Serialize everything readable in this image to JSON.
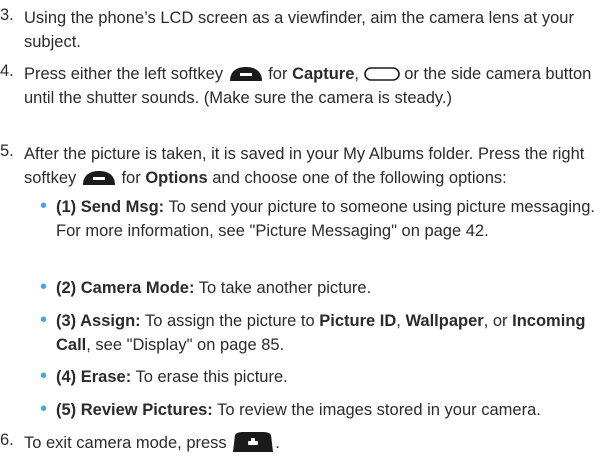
{
  "steps": [
    {
      "num": "3.",
      "text": "Using the phone’s LCD screen as a viewfinder, aim the camera lens at your subject."
    },
    {
      "num": "4.",
      "p1": "Press either the left softkey",
      "b1": "Capture",
      "p2": "for",
      "p3": ",",
      "p4": "or the side camera button until the shutter sounds. (Make sure the camera is steady.)"
    },
    {
      "num": "5.",
      "p1": "After the picture is taken, it is saved in your My Albums folder. Press the right softkey",
      "p2": "for",
      "b1": "Options",
      "p3": "and choose one of the following options:"
    },
    {
      "num": "6.",
      "text": "To exit camera mode, press",
      "end": "."
    }
  ],
  "bullets": [
    {
      "label": "(1) Send Msg:",
      "text": "To send your picture to someone using picture messaging. For more information, see \"Picture Messaging\" on page 42."
    },
    {
      "label": "(2) Camera Mode:",
      "text": "To take another picture."
    },
    {
      "label": "(3) Assign:",
      "t1": "To assign the picture to",
      "b1": "Picture ID",
      "t2": ",",
      "b2": "Wallpaper",
      "t3": ", or",
      "b3": "Incoming Call",
      "t4": ", see \"Display\" on page 85."
    },
    {
      "label": "(4) Erase:",
      "text": "To erase this picture."
    },
    {
      "label": "(5) Review Pictures:",
      "text": "To review the images stored in your camera."
    }
  ],
  "icons": {
    "left_softkey": "left-softkey-icon",
    "right_softkey": "right-softkey-icon",
    "side_button": "side-camera-button-icon",
    "end_key": "end-key-icon"
  },
  "colors": {
    "bullet": "#4aa3e0",
    "text": "#2b2b2b",
    "icon": "#1a1a1a"
  }
}
